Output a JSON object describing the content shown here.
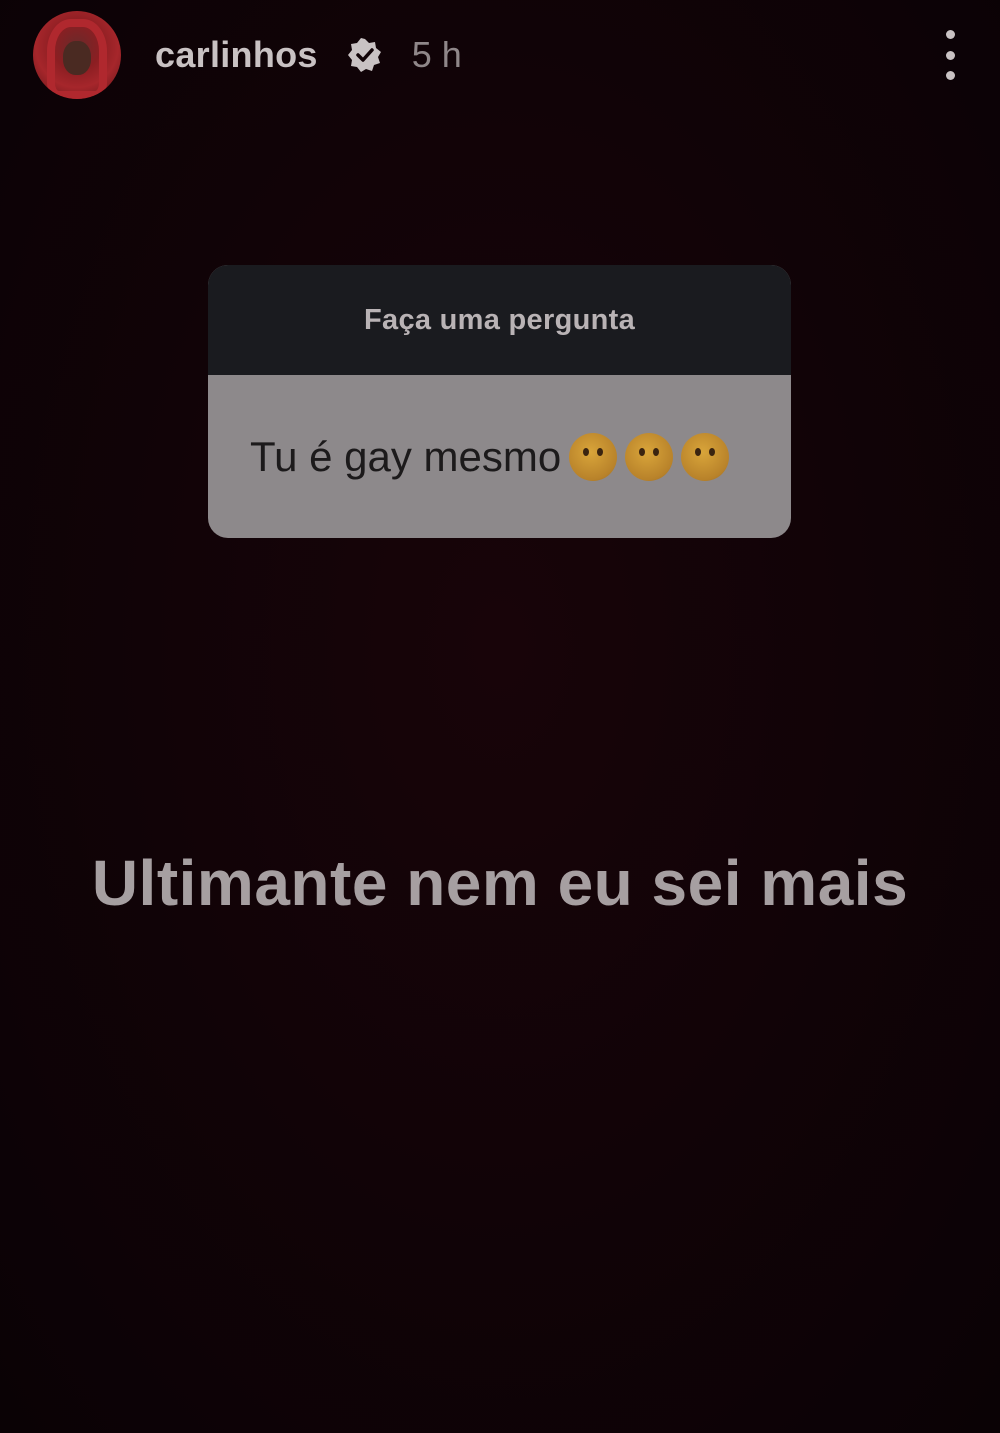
{
  "header": {
    "username": "carlinhos",
    "timestamp": "5 h",
    "avatar_icon": "user-avatar-red-hood",
    "verified_icon": "verified-badge-icon",
    "more_icon": "more-options-icon"
  },
  "question_box": {
    "title": "Faça uma pergunta",
    "question": "Tu é gay mesmo",
    "emoji_icon": "thinking-face-emoji",
    "emoji_count": 3
  },
  "answer": {
    "text": "Ultimante nem eu sei mais"
  },
  "colors": {
    "background": "#110307",
    "question_header_bg": "#1a1b1f",
    "question_body_bg": "#8d898b",
    "answer_text": "#a69fa1"
  }
}
